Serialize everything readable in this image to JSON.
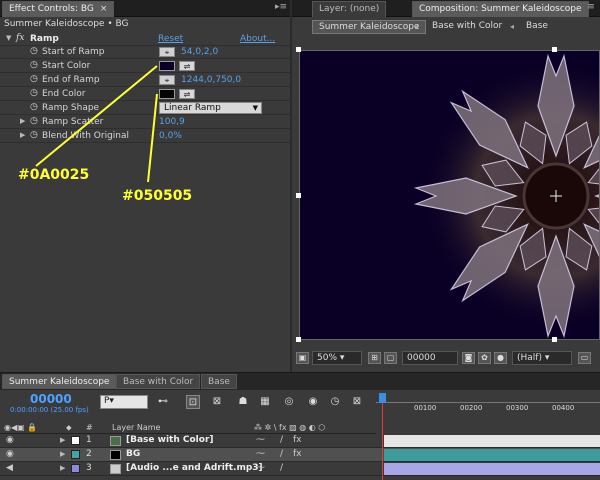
{
  "effect_controls": {
    "tab_label": "Effect Controls: BG",
    "tab_close": "×",
    "subtitle": "Summer Kaleidoscope • BG",
    "effect": {
      "fx_glyph": "fx",
      "name": "Ramp",
      "reset": "Reset",
      "about": "About..."
    },
    "params": [
      {
        "label": "Start of Ramp",
        "value": "54,0,2,0"
      },
      {
        "label": "Start Color"
      },
      {
        "label": "End of Ramp",
        "value": "1244,0,750,0"
      },
      {
        "label": "End Color"
      },
      {
        "label": "Ramp Shape",
        "value": "Linear Ramp"
      },
      {
        "label": "Ramp Scatter",
        "value": "100,9"
      },
      {
        "label": "Blend With Original",
        "value": "0,0%"
      }
    ],
    "start_color": "#0A0025",
    "end_color": "#050505"
  },
  "annotations": {
    "start_color_label": "#0A0025",
    "end_color_label": "#050505",
    "color": "#ffff33"
  },
  "composition": {
    "layer_tab": "Layer: (none)",
    "comp_tab": "Composition: Summer Kaleidoscope",
    "breadcrumbs": [
      "Summer Kaleidoscope",
      "Base with Color",
      "Base"
    ],
    "zoom": "50%",
    "timecode": "00000",
    "resolution": "(Half)",
    "background_color": "#0a0025"
  },
  "timeline": {
    "tabs": [
      "Summer Kaleidoscope",
      "Base with Color",
      "Base"
    ],
    "timecode": "00000",
    "fps": "0:00:00:00 (25.00 fps)",
    "search_placeholder": "P▾",
    "column_name_header": "Layer Name",
    "column_num_header": "#",
    "ruler_ticks": [
      "00100",
      "00200",
      "00300",
      "00400"
    ],
    "layers": [
      {
        "num": "1",
        "name": "[Base with Color]",
        "label_color": "#ffffff",
        "bar_color": "#e6e6e6"
      },
      {
        "num": "2",
        "name": "BG",
        "label_color": "#3fa7a7",
        "bar_color": "#3d9c9c"
      },
      {
        "num": "3",
        "name": "[Audio ...e and Adrift.mp3]",
        "label_color": "#8a8ae0",
        "bar_color": "#a7a7e8"
      }
    ]
  }
}
